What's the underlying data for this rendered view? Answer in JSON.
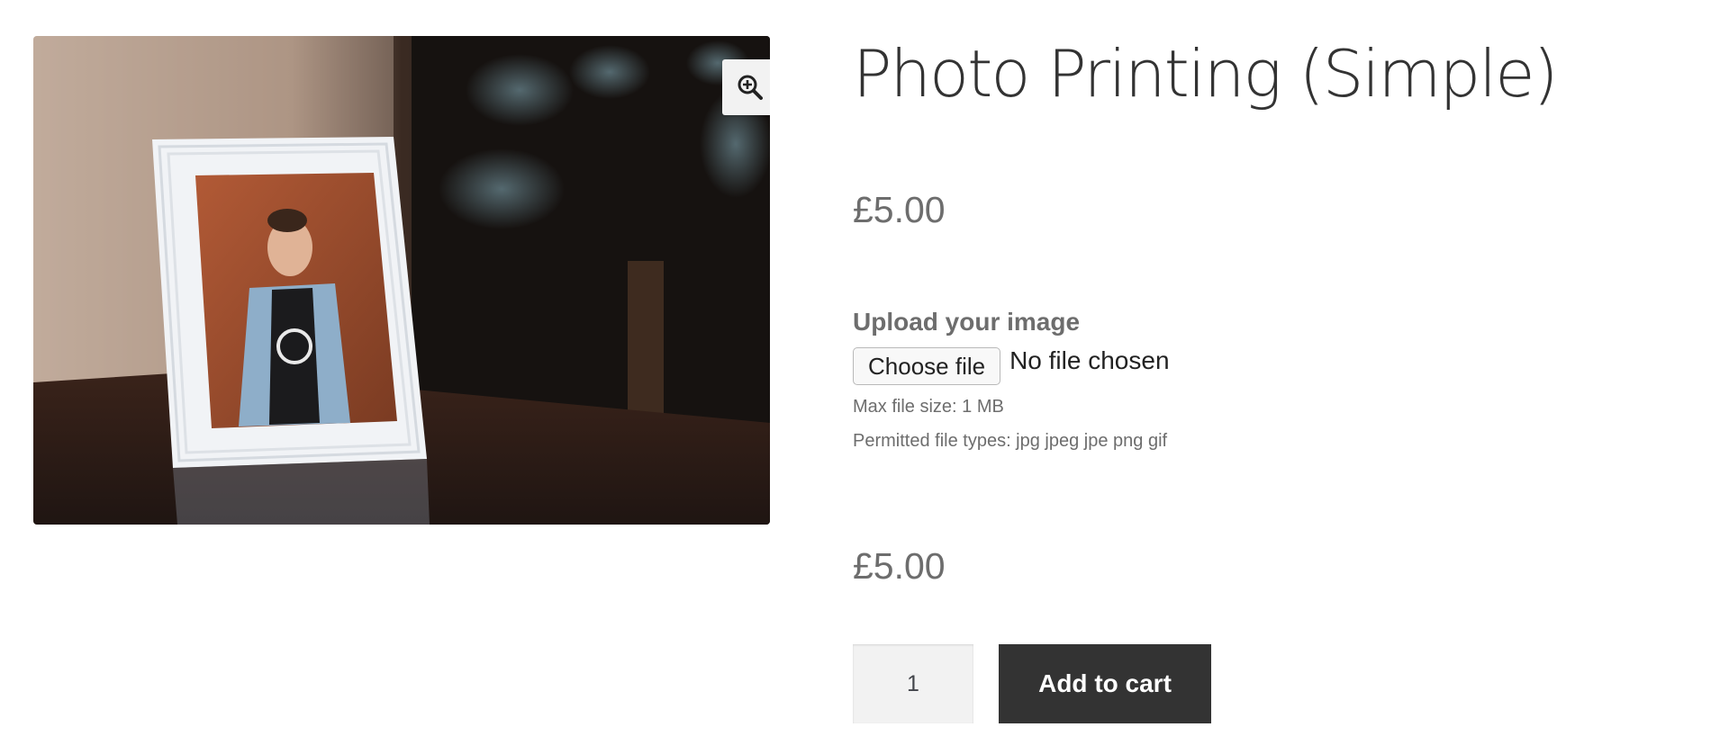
{
  "product": {
    "title": "Photo Printing (Simple)",
    "price": "£5.00",
    "total_price": "£5.00"
  },
  "gallery": {
    "zoom_icon": "magnify-plus-icon"
  },
  "upload": {
    "label": "Upload your image",
    "button_label": "Choose file",
    "status": "No file chosen",
    "max_size": "Max file size: 1 MB",
    "file_types": "Permitted file types: jpg jpeg jpe png gif"
  },
  "cart": {
    "quantity": "1",
    "add_label": "Add to cart"
  },
  "colors": {
    "button_bg": "#333333",
    "text_muted": "#6d6d6d",
    "title": "#333333"
  }
}
